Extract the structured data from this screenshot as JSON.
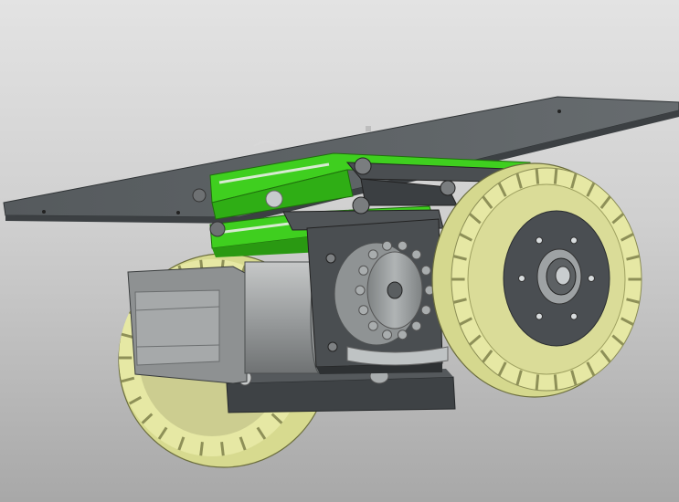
{
  "scene": {
    "subject": "cad-drive-wheel-assembly",
    "colors": {
      "background_top": "#e3e3e3",
      "background_bottom": "#a8a8a8",
      "plate": "#5f6467",
      "suspension_link": "#3fcf1f",
      "tread": "#e6e8a4",
      "hub": "#4a4e52",
      "motor": "#9a9d9e",
      "sprocket": "#b8bcbd",
      "bracket": "#3e4245"
    }
  }
}
